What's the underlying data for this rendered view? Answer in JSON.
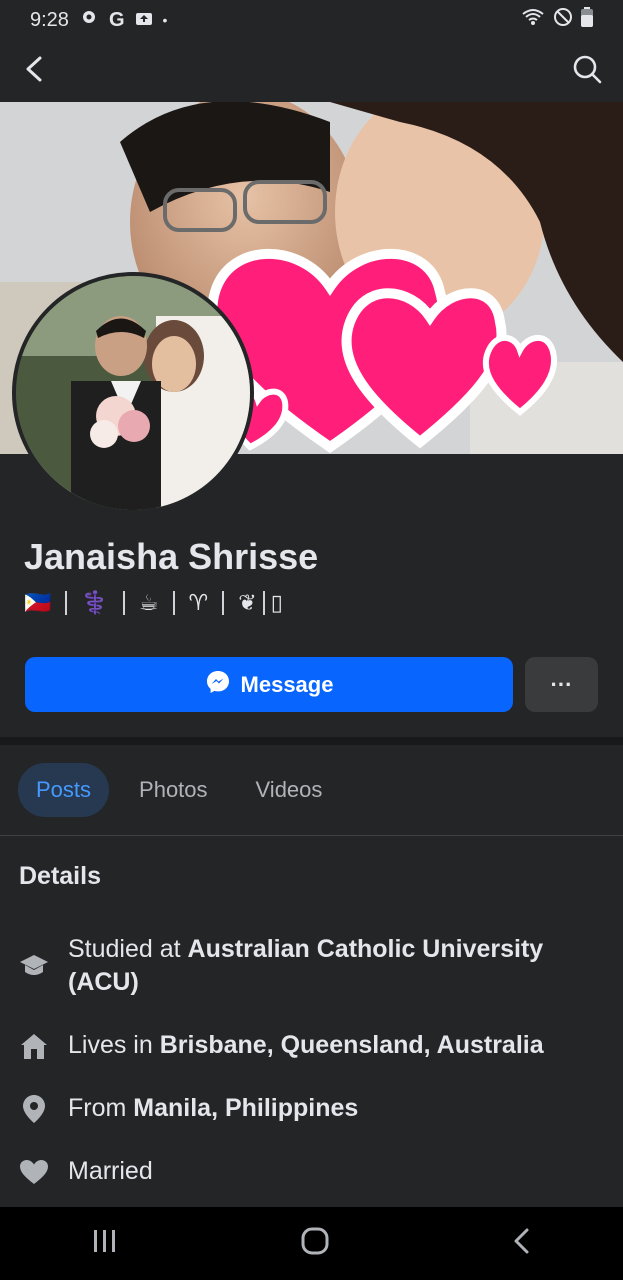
{
  "status_bar": {
    "time": "9:28"
  },
  "profile": {
    "name": "Janaisha Shrisse",
    "bio_emojis": [
      "🇵🇭",
      "⚕️",
      "☕",
      "♈",
      "❦",
      "▯"
    ]
  },
  "actions": {
    "message_label": "Message",
    "more_label": "···"
  },
  "tabs": [
    {
      "label": "Posts",
      "active": true
    },
    {
      "label": "Photos",
      "active": false
    },
    {
      "label": "Videos",
      "active": false
    }
  ],
  "details": {
    "title": "Details",
    "items": [
      {
        "icon": "graduation-cap-icon",
        "prefix": "Studied at ",
        "strong": "Australian Catholic University (ACU)"
      },
      {
        "icon": "home-icon",
        "prefix": "Lives in ",
        "strong": "Brisbane, Queensland, Australia"
      },
      {
        "icon": "location-pin-icon",
        "prefix": "From ",
        "strong": "Manila, Philippines"
      },
      {
        "icon": "heart-icon",
        "prefix": "Married",
        "strong": ""
      }
    ]
  },
  "colors": {
    "background": "#242526",
    "accent_blue": "#0866ff",
    "tab_active_text": "#4599ff",
    "heart_pink": "#ff1f7a"
  }
}
